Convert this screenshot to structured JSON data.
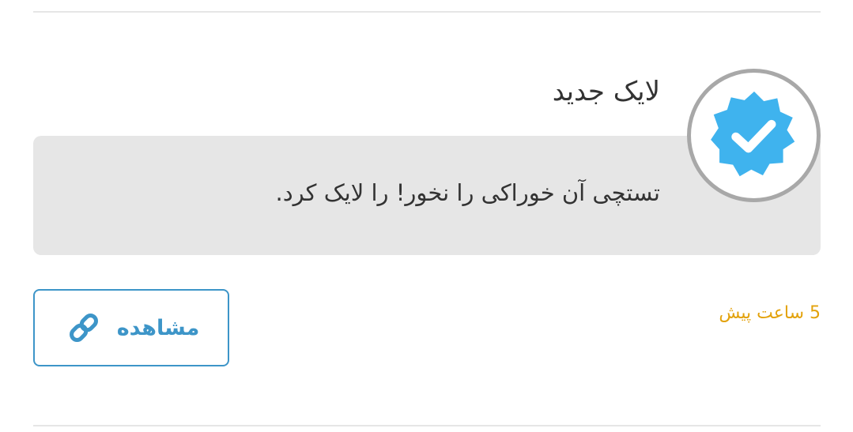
{
  "notification": {
    "title": "لایک جدید",
    "message": "تستچی آن خوراکی را نخور! را لایک کرد.",
    "time": "5 ساعت پیش",
    "view_button_label": "مشاهده",
    "icon": "verified-badge-icon",
    "colors": {
      "badge": "#3fb3ee",
      "accent": "#3d95c8",
      "time": "#e3a20b",
      "box": "#e6e6e6"
    }
  }
}
